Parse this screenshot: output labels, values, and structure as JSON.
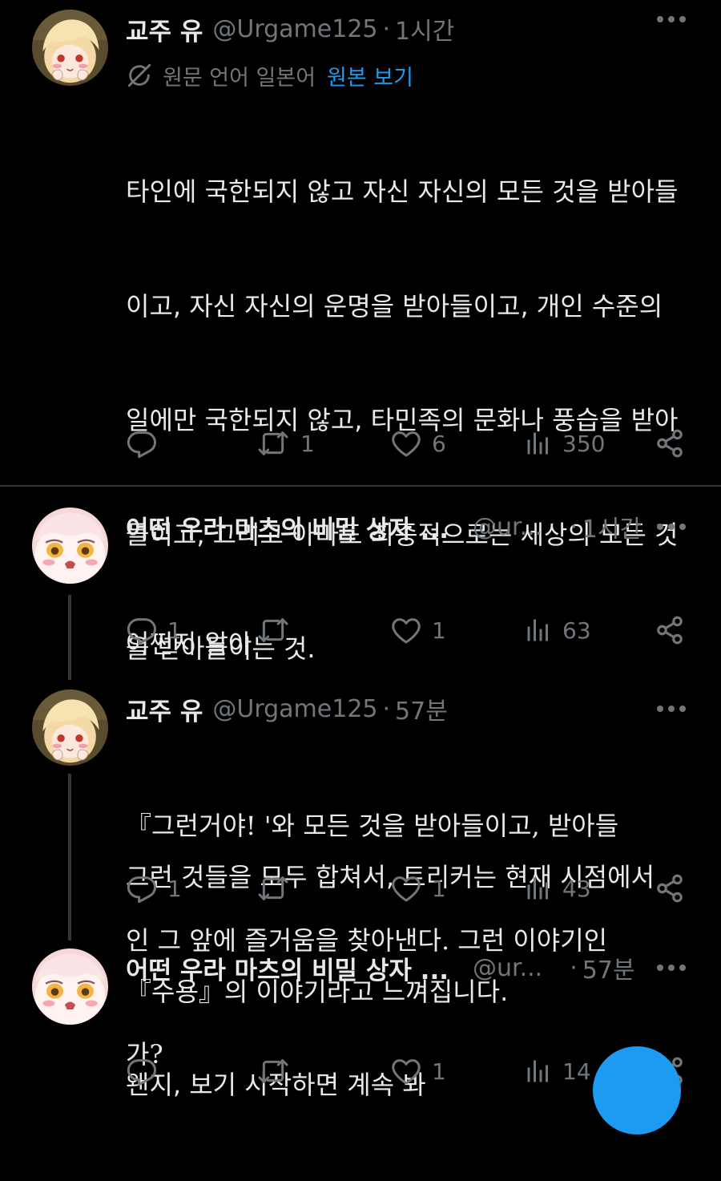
{
  "colors": {
    "background": "#000000",
    "text": "#e7e9ea",
    "muted": "#71767b",
    "link": "#1d9bf0",
    "divider": "#2f3336"
  },
  "tweets": [
    {
      "name": "교주 유",
      "handle": "@Urgame125",
      "separator": "·",
      "time": "1시간",
      "translate": {
        "icon": "translate-icon",
        "label": "원문 언어 일본어",
        "link": "원본 보기"
      },
      "lines": [
        "타인에 국한되지 않고 자신 자신의 모든 것을 받아들",
        "이고, 자신 자신의 운명을 받아들이고, 개인 수준의",
        "일에만 국한되지 않고, 타민족의 문화나 풍습을 받아",
        "들이고, 그리고 아마도 최종적으로는 세상의 모든 것",
        "을 받아들이는 것.",
        "",
        "그런 것들을 모두 합쳐서, 트리커는 현재 시점에서",
        "『수용』의 이야기라고 느껴집니다."
      ],
      "stats": {
        "replies": "",
        "retweets": "1",
        "likes": "6",
        "views": "350"
      }
    },
    {
      "name": "어떤 우라 마츠의 비밀 상자 ...",
      "handle": "@ur...",
      "separator": "·",
      "time": "1시간",
      "lines": [
        "어쩐지 알아"
      ],
      "stats": {
        "replies": "1",
        "retweets": "",
        "likes": "1",
        "views": "63"
      }
    },
    {
      "name": "교주 유",
      "handle": "@Urgame125",
      "separator": "·",
      "time": "57분",
      "lines": [
        "『그런거야! '와 모든 것을 받아들이고, 받아들",
        "인 그 앞에 즐거움을 찾아낸다. 그런 이야기인",
        "가?"
      ],
      "stats": {
        "replies": "1",
        "retweets": "",
        "likes": "1",
        "views": "43"
      }
    },
    {
      "name": "어떤 우라 마츠의 비밀 상자 ...",
      "handle": "@ur...",
      "separator": "·",
      "time": "57분",
      "lines": [
        "왠지, 보기 시작하면 계속 봐"
      ],
      "stats": {
        "replies": "",
        "retweets": "",
        "likes": "1",
        "views": "14"
      }
    }
  ]
}
